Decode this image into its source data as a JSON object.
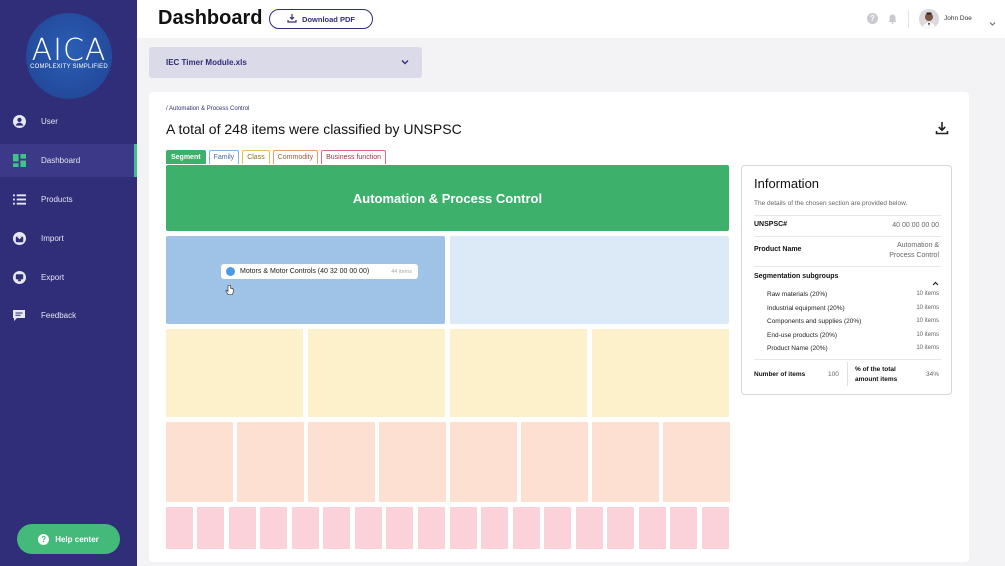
{
  "sidebar": {
    "logo": {
      "name": "AICA",
      "tagline": "COMPLEXITY SIMPLIFIED"
    },
    "items": [
      {
        "label": "User",
        "icon": "user-icon"
      },
      {
        "label": "Dashboard",
        "icon": "dashboard-icon",
        "active": true
      },
      {
        "label": "Products",
        "icon": "list-icon"
      },
      {
        "label": "Import",
        "icon": "import-icon"
      },
      {
        "label": "Export",
        "icon": "export-icon"
      },
      {
        "label": "Feedback",
        "icon": "feedback-icon"
      }
    ],
    "help_label": "Help center"
  },
  "header": {
    "title": "Dashboard",
    "download_label": "Download PDF",
    "user_name": "John Doe"
  },
  "file_select": {
    "value": "IEC Timer Module.xls"
  },
  "main": {
    "breadcrumb": "/ Automation & Process Control",
    "title": "A total of 248 items were classified by UNSPSC",
    "tabs": [
      {
        "label": "Segment"
      },
      {
        "label": "Family"
      },
      {
        "label": "Class"
      },
      {
        "label": "Commodity"
      },
      {
        "label": "Business function"
      }
    ],
    "segment_label": "Automation & Process Control",
    "tooltip": {
      "label": "Motors & Motor Controls (40 32 00 00 00)",
      "count": "44 items"
    }
  },
  "info": {
    "title": "Information",
    "description": "The details of the chosen section are provided below.",
    "unspsc_label": "UNSPSC#",
    "unspsc_value": "40 00 00 00 00",
    "product_name_label": "Product Name",
    "product_name_value_line1": "Automation &",
    "product_name_value_line2": "Process Control",
    "subgroups_label": "Segmentation subgroups",
    "subgroups": [
      {
        "label": "Raw materials (20%)",
        "count": "10 items"
      },
      {
        "label": "Industrial equipment (20%)",
        "count": "10 items"
      },
      {
        "label": "Components and supplies (20%)",
        "count": "10 items"
      },
      {
        "label": "End-use products (20%)",
        "count": "10 items"
      },
      {
        "label": "Product Name (20%)",
        "count": "10 items"
      }
    ],
    "number_items_label": "Number of items",
    "number_items_value": "100",
    "percent_label_line1": "% of the total",
    "percent_label_line2": "amount items",
    "percent_value": "34%"
  },
  "colors": {
    "sidebar": "#302e78",
    "accent_green": "#3db06b",
    "family": "#9fc3e7",
    "class": "#fdf1cc",
    "commodity": "#fde0d1",
    "business_function": "#fcd2da"
  }
}
